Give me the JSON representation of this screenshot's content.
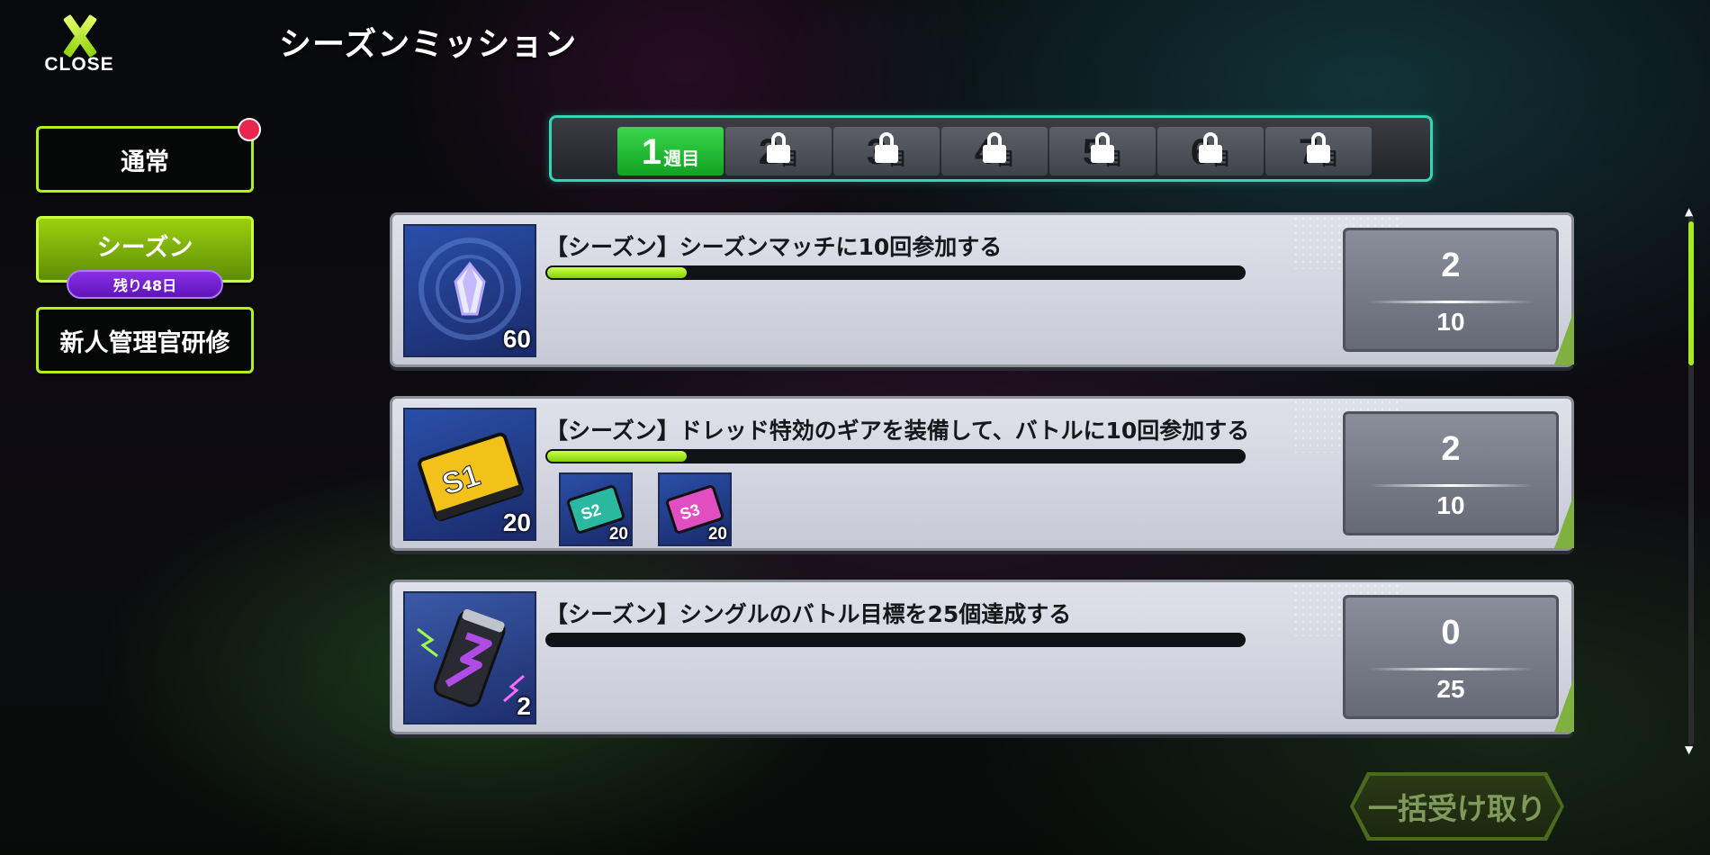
{
  "header": {
    "close_label": "CLOSE",
    "title": "シーズンミッション"
  },
  "nav": {
    "items": [
      {
        "label": "通常",
        "active": false,
        "badge": true
      },
      {
        "label": "シーズン",
        "active": true,
        "remaining": "残り48日"
      },
      {
        "label": "新人管理官研修",
        "active": false
      }
    ]
  },
  "weeks": [
    {
      "num": "1",
      "suffix": "週目",
      "active": true,
      "locked": false
    },
    {
      "num": "2",
      "suffix": "目",
      "active": false,
      "locked": true
    },
    {
      "num": "3",
      "suffix": "目",
      "active": false,
      "locked": true
    },
    {
      "num": "4",
      "suffix": "目",
      "active": false,
      "locked": true
    },
    {
      "num": "5",
      "suffix": "目",
      "active": false,
      "locked": true
    },
    {
      "num": "6",
      "suffix": "目",
      "active": false,
      "locked": true
    },
    {
      "num": "7",
      "suffix": "目",
      "active": false,
      "locked": true
    }
  ],
  "missions": [
    {
      "title": "【シーズン】シーズンマッチに10回参加する",
      "progress": 0.2,
      "current": "2",
      "goal": "10",
      "reward": {
        "icon": "crystal-icon",
        "qty": "60"
      },
      "sub_rewards": []
    },
    {
      "title": "【シーズン】ドレッド特効のギアを装備して、バトルに10回参加する",
      "progress": 0.2,
      "current": "2",
      "goal": "10",
      "reward": {
        "icon": "ability-chip-s1-icon",
        "qty": "20",
        "chip_text": "S1"
      },
      "sub_rewards": [
        {
          "icon": "ability-chip-s2-icon",
          "qty": "20",
          "chip_text": "S2",
          "color": "#2bb8a0"
        },
        {
          "icon": "ability-chip-s3-icon",
          "qty": "20",
          "chip_text": "S3",
          "color": "#e04ec2"
        }
      ]
    },
    {
      "title": "【シーズン】シングルのバトル目標を25個達成する",
      "progress": 0,
      "current": "0",
      "goal": "25",
      "reward": {
        "icon": "energy-drink-icon",
        "qty": "2"
      },
      "sub_rewards": []
    }
  ],
  "footer": {
    "claim_all_label": "一括受け取り"
  },
  "colors": {
    "accent": "#b4f01a",
    "week_active": "#1fb532",
    "teal_border": "#32d6b4",
    "badge": "#e8264e",
    "remain_pill": "#7a24d4"
  }
}
